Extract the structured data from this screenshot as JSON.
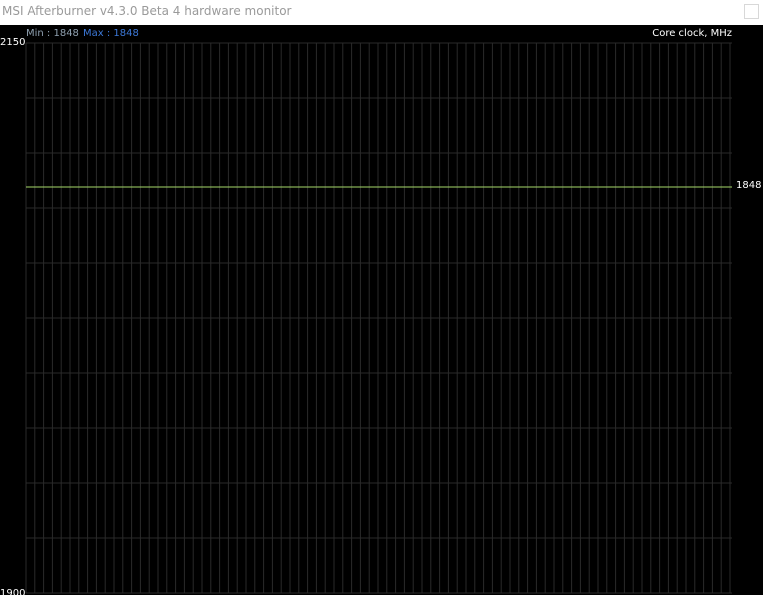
{
  "window": {
    "title": "MSI Afterburner v4.3.0 Beta 4 hardware monitor"
  },
  "graph": {
    "name": "Core clock, MHz",
    "min_label": "Min : 1848",
    "max_label": "Max : 1848",
    "current_label": "1848",
    "axis_max_label": "2150",
    "axis_min_label": "1900"
  },
  "chart_data": {
    "type": "line",
    "ylabel": "Core clock, MHz",
    "ylim": [
      1900,
      2150
    ],
    "series": [
      {
        "name": "Core clock, MHz",
        "values": [
          1848,
          1848
        ],
        "color": "#a6d96a"
      }
    ],
    "min": 1848,
    "max": 1848,
    "current": 1848,
    "grid": true
  },
  "colors": {
    "background": "#000000",
    "grid": "#2a2a2a",
    "line": "#a6d96a",
    "min_text": "#8fa0b0",
    "max_text": "#3c78d8"
  }
}
